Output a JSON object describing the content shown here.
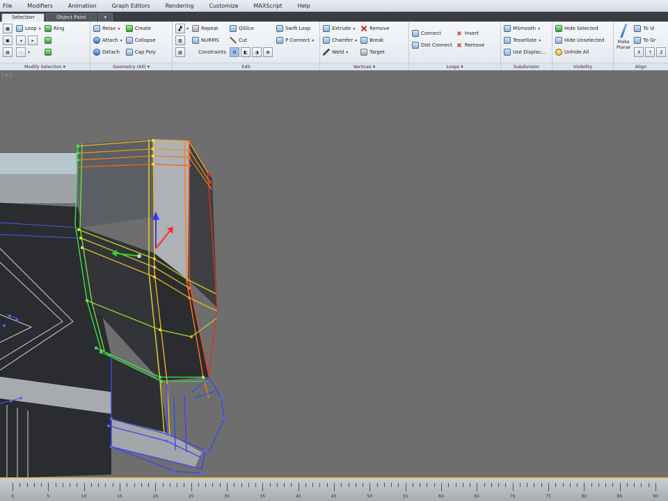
{
  "menu": [
    "File",
    "Modifiers",
    "Animation",
    "Graph Editors",
    "Rendering",
    "Customize",
    "MAXScript",
    "Help"
  ],
  "tabs": [
    {
      "label": "Selection",
      "active": true
    },
    {
      "label": "Object Paint",
      "active": false
    }
  ],
  "tab_dropdown": "▾",
  "ribbon": {
    "modify_selection": {
      "footer": "Modify Selection ▾",
      "items": [
        "Loop",
        "Ring"
      ]
    },
    "geometry_all": {
      "footer": "Geometry (All) ▾",
      "items": [
        "Relax",
        "Attach",
        "Detach",
        "Create",
        "Collapse",
        "Cap Poly"
      ]
    },
    "edit": {
      "footer": "Edit",
      "items": [
        "Repeat",
        "NURMS",
        "Constraints",
        "QSlice",
        "Cut",
        "Swift Loop",
        "P Connect"
      ]
    },
    "vertices": {
      "footer": "Vertices ▾",
      "items": [
        "Extrude",
        "Chamfer",
        "Weld",
        "Remove",
        "Break",
        "Target"
      ]
    },
    "loops": {
      "footer": "Loops ▾",
      "items": [
        "Connect",
        "Dist Connect",
        "Insert",
        "Remove"
      ]
    },
    "subdivision": {
      "footer": "Subdivision",
      "items": [
        "MSmooth",
        "Tessellate",
        "Use Displac..."
      ]
    },
    "visibility": {
      "footer": "Visibility",
      "items": [
        "Hide Selected",
        "Hide Unselected",
        "Unhide All"
      ]
    },
    "align": {
      "footer": "Align",
      "make_planar": "Make Planar",
      "items": [
        "To Vi",
        "To Gr"
      ]
    }
  },
  "viewport": {
    "label": "[ + ]"
  },
  "timeline": {
    "labels": [
      "0",
      "5",
      "10",
      "15",
      "20",
      "25",
      "30",
      "35",
      "40",
      "45",
      "50",
      "55",
      "60",
      "65",
      "70",
      "75",
      "80",
      "85",
      "90"
    ]
  },
  "colors": {
    "viewport_bg": "#6e6e6e",
    "selection_ramp": [
      "#2ee64b",
      "#e6d428",
      "#ff7b1a",
      "#e0321b",
      "#3a48e8"
    ],
    "ribbon_bg": "#eef1f5"
  }
}
